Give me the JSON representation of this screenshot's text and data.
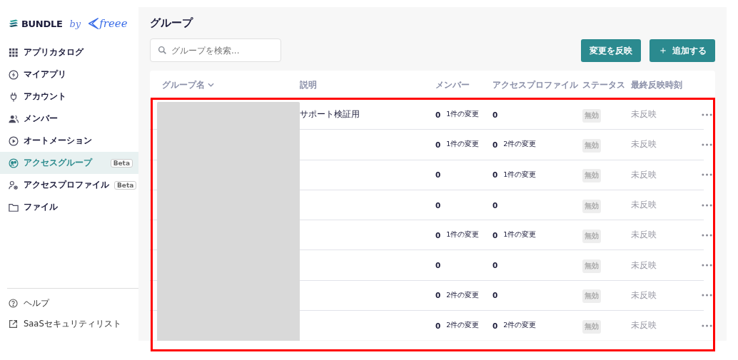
{
  "brand": {
    "name": "BUNDLE",
    "by": "by",
    "partner": "freee"
  },
  "sidebar": {
    "items": [
      {
        "label": "アプリカタログ",
        "selected": false
      },
      {
        "label": "マイアプリ",
        "selected": false
      },
      {
        "label": "アカウント",
        "selected": false
      },
      {
        "label": "メンバー",
        "selected": false
      },
      {
        "label": "オートメーション",
        "selected": false
      },
      {
        "label": "アクセスグループ",
        "selected": true,
        "badge": "Beta"
      },
      {
        "label": "アクセスプロファイル",
        "selected": false,
        "badge": "Beta"
      },
      {
        "label": "ファイル",
        "selected": false
      }
    ],
    "footer": [
      {
        "label": "ヘルプ"
      },
      {
        "label": "SaaSセキュリティリスト"
      }
    ]
  },
  "page": {
    "title": "グループ",
    "search": {
      "placeholder": "グループを検索..."
    },
    "buttons": [
      {
        "label": "変更を反映",
        "kind": "plain"
      },
      {
        "label": "追加する",
        "kind": "add",
        "icon": "＋"
      }
    ]
  },
  "table": {
    "columns": [
      "グループ名",
      "説明",
      "メンバー",
      "アクセスプロファイル",
      "ステータス",
      "最終反映時刻"
    ],
    "rows": [
      {
        "description": "サポート検証用",
        "members": "0",
        "member_changes": "1件の変更",
        "profiles": "0",
        "status": "無効",
        "last_reflected": "未反映"
      },
      {
        "members": "0",
        "member_changes": "1件の変更",
        "profiles": "0",
        "profile_changes": "2件の変更",
        "status": "無効",
        "last_reflected": "未反映"
      },
      {
        "members": "0",
        "profiles": "0",
        "profile_changes": "1件の変更",
        "status": "無効",
        "last_reflected": "未反映"
      },
      {
        "members": "0",
        "profiles": "0",
        "status": "無効",
        "last_reflected": "未反映"
      },
      {
        "members": "0",
        "member_changes": "1件の変更",
        "profiles": "0",
        "profile_changes": "1件の変更",
        "status": "無効",
        "last_reflected": "未反映"
      },
      {
        "members": "0",
        "profiles": "0",
        "status": "無効",
        "last_reflected": "未反映"
      },
      {
        "members": "0",
        "member_changes": "2件の変更",
        "profiles": "0",
        "status": "無効",
        "last_reflected": "未反映"
      },
      {
        "members": "0",
        "member_changes": "2件の変更",
        "profiles": "0",
        "profile_changes": "2件の変更",
        "status": "無効",
        "last_reflected": "未反映"
      }
    ]
  }
}
